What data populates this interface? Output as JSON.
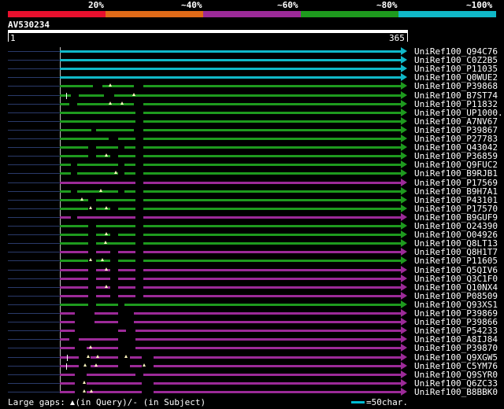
{
  "legend": {
    "labels": [
      "20%",
      "~40%",
      "~60%",
      "~80%",
      "~100%"
    ],
    "colors": [
      "#e8102e",
      "#e06a18",
      "#9c2a98",
      "#1e9a1e",
      "#10b8c8"
    ]
  },
  "query": {
    "name": "AV530234",
    "start": "1",
    "end": "365"
  },
  "hits": [
    {
      "name": "UniRef100_Q94C76",
      "color": "#10b8c8",
      "gaps": [],
      "qmarks": [],
      "smarks": []
    },
    {
      "name": "UniRef100_C0Z2B5",
      "color": "#10b8c8",
      "gaps": [],
      "qmarks": [],
      "smarks": []
    },
    {
      "name": "UniRef100_P11035",
      "color": "#10b8c8",
      "gaps": [],
      "qmarks": [],
      "smarks": []
    },
    {
      "name": "UniRef100_Q0WUE2",
      "color": "#10b8c8",
      "gaps": [],
      "qmarks": [],
      "smarks": []
    },
    {
      "name": "UniRef100_P39868",
      "color": "#1e9a1e",
      "gaps": [
        [
          118,
          130
        ],
        [
          170,
          182
        ]
      ],
      "qmarks": [
        140
      ],
      "smarks": []
    },
    {
      "name": "UniRef100_B7ST74",
      "color": "#1e9a1e",
      "gaps": [
        [
          90,
          100
        ],
        [
          132,
          145
        ]
      ],
      "qmarks": [
        170
      ],
      "smarks": [
        84
      ]
    },
    {
      "name": "UniRef100_P11832",
      "color": "#1e9a1e",
      "gaps": [
        [
          88,
          98
        ],
        [
          170,
          182
        ]
      ],
      "qmarks": [
        140,
        155
      ],
      "smarks": []
    },
    {
      "name": "UniRef100_UP1000..",
      "color": "#1e9a1e",
      "gaps": [
        [
          172,
          182
        ]
      ],
      "qmarks": [],
      "smarks": []
    },
    {
      "name": "UniRef100_A7NV67",
      "color": "#1e9a1e",
      "gaps": [
        [
          172,
          182
        ]
      ],
      "qmarks": [],
      "smarks": []
    },
    {
      "name": "UniRef100_P39867",
      "color": "#1e9a1e",
      "gaps": [
        [
          116,
          122
        ],
        [
          170,
          182
        ]
      ],
      "qmarks": [],
      "smarks": []
    },
    {
      "name": "UniRef100_P27783",
      "color": "#1e9a1e",
      "gaps": [
        [
          138,
          150
        ],
        [
          172,
          182
        ]
      ],
      "qmarks": [],
      "smarks": []
    },
    {
      "name": "UniRef100_Q43042",
      "color": "#1e9a1e",
      "gaps": [
        [
          112,
          122
        ],
        [
          150,
          158
        ],
        [
          172,
          182
        ]
      ],
      "qmarks": [],
      "smarks": []
    },
    {
      "name": "UniRef100_P36859",
      "color": "#1e9a1e",
      "gaps": [
        [
          112,
          122
        ],
        [
          140,
          150
        ],
        [
          172,
          182
        ]
      ],
      "qmarks": [
        135
      ],
      "smarks": []
    },
    {
      "name": "UniRef100_Q9FUC2",
      "color": "#1e9a1e",
      "gaps": [
        [
          90,
          98
        ],
        [
          150,
          158
        ],
        [
          172,
          182
        ]
      ],
      "qmarks": [],
      "smarks": []
    },
    {
      "name": "UniRef100_B9RJB1",
      "color": "#1e9a1e",
      "gaps": [
        [
          90,
          98
        ],
        [
          150,
          158
        ],
        [
          172,
          182
        ]
      ],
      "qmarks": [
        147
      ],
      "smarks": []
    },
    {
      "name": "UniRef100_P17569",
      "color": "#9c2a98",
      "gaps": [
        [
          172,
          182
        ]
      ],
      "qmarks": [],
      "smarks": []
    },
    {
      "name": "UniRef100_B9H7A1",
      "color": "#1e9a1e",
      "gaps": [
        [
          90,
          98
        ],
        [
          150,
          158
        ],
        [
          172,
          182
        ]
      ],
      "qmarks": [
        128
      ],
      "smarks": []
    },
    {
      "name": "UniRef100_P43101",
      "color": "#1e9a1e",
      "gaps": [
        [
          112,
          122
        ],
        [
          172,
          182
        ]
      ],
      "qmarks": [
        104
      ],
      "smarks": []
    },
    {
      "name": "UniRef100_P17570",
      "color": "#1e9a1e",
      "gaps": [
        [
          112,
          122
        ],
        [
          140,
          150
        ],
        [
          172,
          182
        ]
      ],
      "qmarks": [
        115,
        135
      ],
      "smarks": []
    },
    {
      "name": "UniRef100_B9GUF9",
      "color": "#9c2a98",
      "gaps": [
        [
          90,
          98
        ],
        [
          172,
          182
        ]
      ],
      "qmarks": [],
      "smarks": []
    },
    {
      "name": "UniRef100_O24390",
      "color": "#1e9a1e",
      "gaps": [
        [
          112,
          122
        ],
        [
          172,
          182
        ]
      ],
      "qmarks": [],
      "smarks": []
    },
    {
      "name": "UniRef100_O04926",
      "color": "#1e9a1e",
      "gaps": [
        [
          112,
          122
        ],
        [
          140,
          150
        ],
        [
          172,
          182
        ]
      ],
      "qmarks": [
        135
      ],
      "smarks": []
    },
    {
      "name": "UniRef100_Q8LT13",
      "color": "#1e9a1e",
      "gaps": [
        [
          112,
          122
        ],
        [
          172,
          182
        ]
      ],
      "qmarks": [
        134
      ],
      "smarks": []
    },
    {
      "name": "UniRef100_Q8H1T7",
      "color": "#9c2a98",
      "gaps": [
        [
          112,
          122
        ],
        [
          140,
          150
        ],
        [
          172,
          182
        ]
      ],
      "qmarks": [],
      "smarks": []
    },
    {
      "name": "UniRef100_P11605",
      "color": "#1e9a1e",
      "gaps": [
        [
          112,
          122
        ],
        [
          140,
          150
        ],
        [
          172,
          182
        ]
      ],
      "qmarks": [
        115,
        130
      ],
      "smarks": []
    },
    {
      "name": "UniRef100_Q5QIV6",
      "color": "#9c2a98",
      "gaps": [
        [
          112,
          122
        ],
        [
          140,
          150
        ],
        [
          172,
          182
        ]
      ],
      "qmarks": [
        135
      ],
      "smarks": []
    },
    {
      "name": "UniRef100_Q3C1F0",
      "color": "#9c2a98",
      "gaps": [
        [
          112,
          122
        ],
        [
          140,
          150
        ],
        [
          172,
          182
        ]
      ],
      "qmarks": [],
      "smarks": []
    },
    {
      "name": "UniRef100_Q10NX4",
      "color": "#9c2a98",
      "gaps": [
        [
          112,
          122
        ],
        [
          140,
          150
        ],
        [
          172,
          182
        ]
      ],
      "qmarks": [
        135
      ],
      "smarks": []
    },
    {
      "name": "UniRef100_P08509",
      "color": "#9c2a98",
      "gaps": [
        [
          112,
          122
        ],
        [
          140,
          150
        ],
        [
          172,
          182
        ]
      ],
      "qmarks": [],
      "smarks": []
    },
    {
      "name": "UniRef100_Q93XS1",
      "color": "#1e9a1e",
      "gaps": [
        [
          112,
          122
        ],
        [
          150,
          158
        ]
      ],
      "qmarks": [],
      "smarks": []
    },
    {
      "name": "UniRef100_P39869",
      "color": "#9c2a98",
      "gaps": [
        [
          95,
          120
        ],
        [
          150,
          170
        ]
      ],
      "qmarks": [],
      "smarks": []
    },
    {
      "name": "UniRef100_P39866",
      "color": "#9c2a98",
      "gaps": [
        [
          95,
          120
        ],
        [
          150,
          170
        ]
      ],
      "qmarks": [],
      "smarks": []
    },
    {
      "name": "UniRef100_P54233",
      "color": "#9c2a98",
      "gaps": [
        [
          95,
          150
        ],
        [
          160,
          172
        ]
      ],
      "qmarks": [],
      "smarks": []
    },
    {
      "name": "UniRef100_A8IJ84",
      "color": "#9c2a98",
      "gaps": [
        [
          88,
          100
        ],
        [
          150,
          172
        ]
      ],
      "qmarks": [],
      "smarks": []
    },
    {
      "name": "UniRef100_P39870",
      "color": "#9c2a98",
      "gaps": [
        [
          95,
          110
        ],
        [
          150,
          172
        ]
      ],
      "qmarks": [
        115
      ],
      "smarks": []
    },
    {
      "name": "UniRef100_Q9XGW5",
      "color": "#9c2a98",
      "gaps": [
        [
          100,
          115
        ],
        [
          150,
          165
        ],
        [
          180,
          195
        ]
      ],
      "qmarks": [
        112,
        124,
        160
      ],
      "smarks": [
        85
      ]
    },
    {
      "name": "UniRef100_C5YM76",
      "color": "#9c2a98",
      "gaps": [
        [
          100,
          115
        ],
        [
          150,
          165
        ],
        [
          180,
          195
        ]
      ],
      "qmarks": [
        108,
        122,
        183
      ],
      "smarks": [
        84
      ]
    },
    {
      "name": "UniRef100_Q9SYR0",
      "color": "#9c2a98",
      "gaps": [
        [
          95,
          110
        ],
        [
          172,
          182
        ]
      ],
      "qmarks": [],
      "smarks": []
    },
    {
      "name": "UniRef100_Q6ZC33",
      "color": "#9c2a98",
      "gaps": [
        [
          95,
          110
        ],
        [
          180,
          195
        ]
      ],
      "qmarks": [
        107
      ],
      "smarks": []
    },
    {
      "name": "UniRef100_B8BBK0",
      "color": "#9c2a98",
      "gaps": [
        [
          95,
          110
        ],
        [
          180,
          195
        ]
      ],
      "qmarks": [
        107,
        116
      ],
      "smarks": []
    }
  ],
  "footer": {
    "text_prefix": "Large gaps:",
    "text_query": "(in Query)/",
    "text_subject": "(in Subject)",
    "scale_label": "=50char."
  }
}
